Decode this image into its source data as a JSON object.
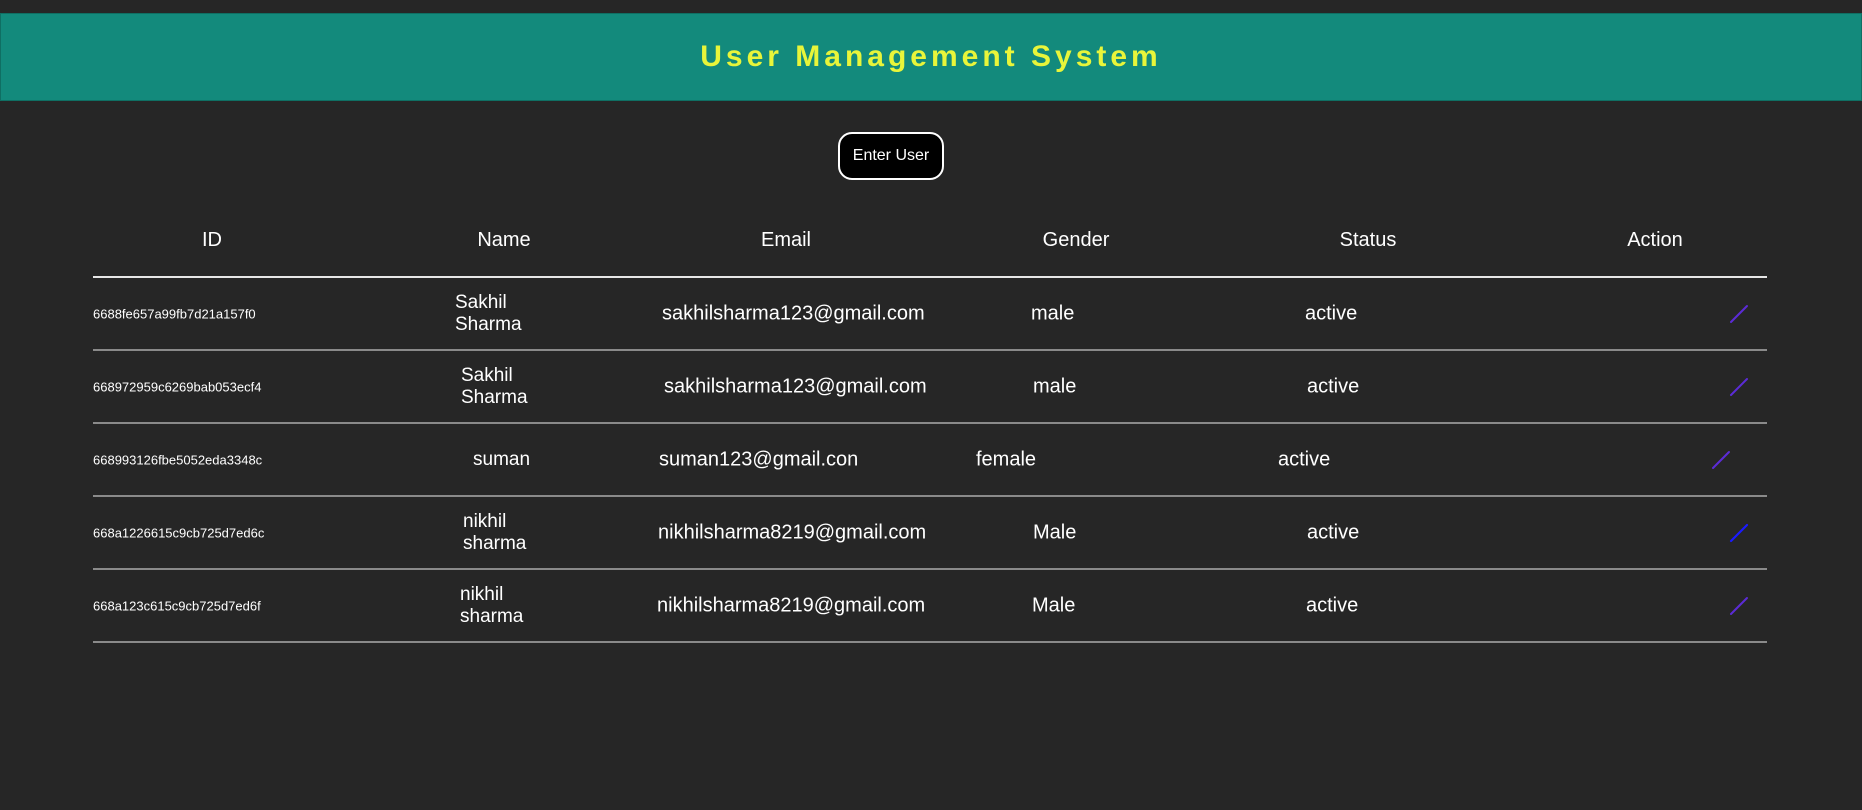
{
  "header": {
    "title": "User Management System"
  },
  "actions": {
    "enter_user_label": "Enter User"
  },
  "table": {
    "columns": [
      "ID",
      "Name",
      "Email",
      "Gender",
      "Status",
      "Action"
    ],
    "rows": [
      {
        "id": "6688fe657a99fb7d21a157f0",
        "name": "Sakhil Sharma",
        "email": "sakhilsharma123@gmail.com",
        "gender": "male",
        "status": "active"
      },
      {
        "id": "668972959c6269bab053ecf4",
        "name": "Sakhil Sharma",
        "email": "sakhilsharma123@gmail.com",
        "gender": "male",
        "status": "active"
      },
      {
        "id": "668993126fbe5052eda3348c",
        "name": "suman",
        "email": "suman123@gmail.con",
        "gender": "female",
        "status": "active"
      },
      {
        "id": "668a1226615c9cb725d7ed6c",
        "name": "nikhil sharma",
        "email": "nikhilsharma8219@gmail.com",
        "gender": "Male",
        "status": "active"
      },
      {
        "id": "668a123c615c9cb725d7ed6f",
        "name": "nikhil sharma",
        "email": "nikhilsharma8219@gmail.com",
        "gender": "Male",
        "status": "active"
      }
    ]
  },
  "colors": {
    "header_bg": "#138a7c",
    "title": "#e8f53a",
    "page_bg": "#262626",
    "edit_icon": "#5b2bd6",
    "edit_icon_active": "#1a1aff"
  },
  "icons": {
    "action": "edit-pencil-icon"
  }
}
